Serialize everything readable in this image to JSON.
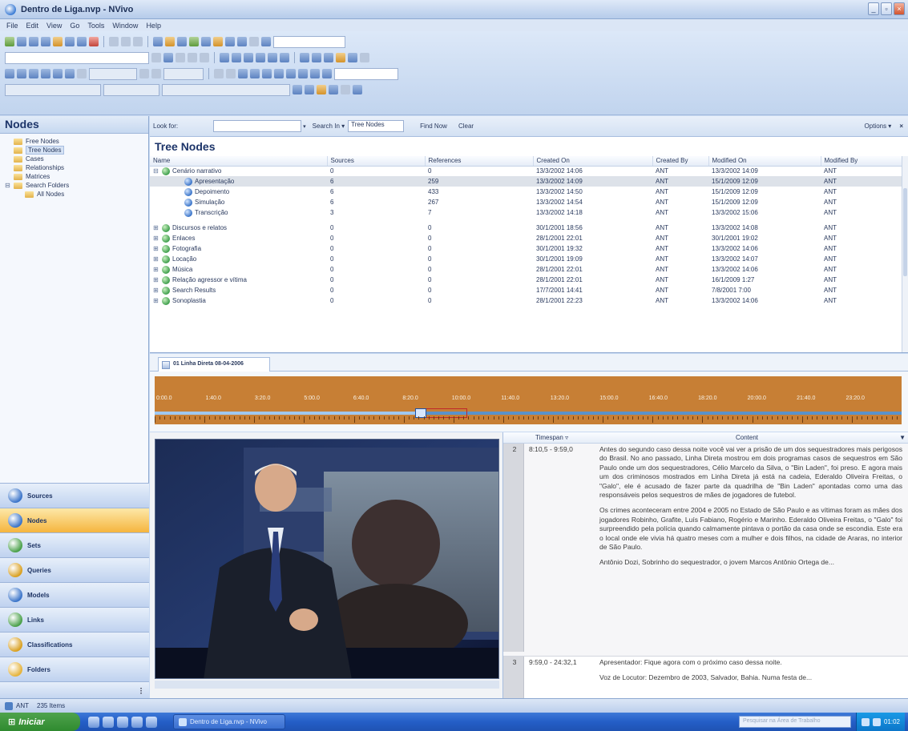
{
  "window": {
    "title": "Dentro de Liga.nvp - NVivo",
    "min_glyph": "_",
    "max_glyph": "▫",
    "close_glyph": "×"
  },
  "menu": [
    "File",
    "Edit",
    "View",
    "Go",
    "Tools",
    "Window",
    "Help"
  ],
  "nav": {
    "header": "Nodes",
    "tree": [
      {
        "label": "Free Nodes",
        "indent": 0,
        "icon": "folder-icon",
        "selected": false,
        "expander": ""
      },
      {
        "label": "Tree Nodes",
        "indent": 0,
        "icon": "folder-icon",
        "selected": true,
        "expander": ""
      },
      {
        "label": "Cases",
        "indent": 0,
        "icon": "folder-icon",
        "selected": false,
        "expander": ""
      },
      {
        "label": "Relationships",
        "indent": 0,
        "icon": "folder-icon",
        "selected": false,
        "expander": ""
      },
      {
        "label": "Matrices",
        "indent": 0,
        "icon": "folder-icon",
        "selected": false,
        "expander": ""
      },
      {
        "label": "Search Folders",
        "indent": 0,
        "icon": "folder-icon",
        "selected": false,
        "expander": "⊟"
      },
      {
        "label": "All Nodes",
        "indent": 1,
        "icon": "folder-icon",
        "selected": false,
        "expander": ""
      }
    ],
    "buttons": [
      {
        "label": "Sources",
        "icon": "sources-icon",
        "active": false
      },
      {
        "label": "Nodes",
        "icon": "nodes-icon",
        "active": true
      },
      {
        "label": "Sets",
        "icon": "sets-icon",
        "active": false
      },
      {
        "label": "Queries",
        "icon": "queries-icon",
        "active": false
      },
      {
        "label": "Models",
        "icon": "models-icon",
        "active": false
      },
      {
        "label": "Links",
        "icon": "links-icon",
        "active": false
      },
      {
        "label": "Classifications",
        "icon": "classifications-icon",
        "active": false
      },
      {
        "label": "Folders",
        "icon": "folders-icon",
        "active": false
      }
    ],
    "configure_glyph": "⁝"
  },
  "findbar": {
    "look_for_label": "Look for:",
    "search_in_label": "Search In ▾",
    "search_in_value": "Tree Nodes",
    "find_now": "Find Now",
    "clear": "Clear",
    "options": "Options ▾",
    "close_glyph": "×"
  },
  "list": {
    "title": "Tree Nodes",
    "columns": [
      "Name",
      "Sources",
      "References",
      "Created On",
      "Created By",
      "Modified On",
      "Modified By"
    ],
    "rows": [
      {
        "name": "Cenário narrativo",
        "sources": "0",
        "references": "0",
        "created_on": "13/3/2002 14:06",
        "created_by": "ANT",
        "modified_on": "13/3/2002 14:09",
        "modified_by": "ANT",
        "level": 0,
        "expander": "⊟",
        "selected": false,
        "gap_after": false
      },
      {
        "name": "Apresentação",
        "sources": "6",
        "references": "259",
        "created_on": "13/3/2002 14:09",
        "created_by": "ANT",
        "modified_on": "15/1/2009 12:09",
        "modified_by": "ANT",
        "level": 1,
        "expander": "",
        "selected": true,
        "gap_after": false
      },
      {
        "name": "Depoimento",
        "sources": "6",
        "references": "433",
        "created_on": "13/3/2002 14:50",
        "created_by": "ANT",
        "modified_on": "15/1/2009 12:09",
        "modified_by": "ANT",
        "level": 1,
        "expander": "",
        "selected": false,
        "gap_after": false
      },
      {
        "name": "Simulação",
        "sources": "6",
        "references": "267",
        "created_on": "13/3/2002 14:54",
        "created_by": "ANT",
        "modified_on": "15/1/2009 12:09",
        "modified_by": "ANT",
        "level": 1,
        "expander": "",
        "selected": false,
        "gap_after": false
      },
      {
        "name": "Transcrição",
        "sources": "3",
        "references": "7",
        "created_on": "13/3/2002 14:18",
        "created_by": "ANT",
        "modified_on": "13/3/2002 15:06",
        "modified_by": "ANT",
        "level": 1,
        "expander": "",
        "selected": false,
        "gap_after": true
      },
      {
        "name": "Discursos e relatos",
        "sources": "0",
        "references": "0",
        "created_on": "30/1/2001 18:56",
        "created_by": "ANT",
        "modified_on": "13/3/2002 14:08",
        "modified_by": "ANT",
        "level": 0,
        "expander": "⊞",
        "selected": false,
        "gap_after": false
      },
      {
        "name": "Enlaces",
        "sources": "0",
        "references": "0",
        "created_on": "28/1/2001 22:01",
        "created_by": "ANT",
        "modified_on": "30/1/2001 19:02",
        "modified_by": "ANT",
        "level": 0,
        "expander": "⊞",
        "selected": false,
        "gap_after": false
      },
      {
        "name": "Fotografia",
        "sources": "0",
        "references": "0",
        "created_on": "30/1/2001 19:32",
        "created_by": "ANT",
        "modified_on": "13/3/2002 14:06",
        "modified_by": "ANT",
        "level": 0,
        "expander": "⊞",
        "selected": false,
        "gap_after": false
      },
      {
        "name": "Locação",
        "sources": "0",
        "references": "0",
        "created_on": "30/1/2001 19:09",
        "created_by": "ANT",
        "modified_on": "13/3/2002 14:07",
        "modified_by": "ANT",
        "level": 0,
        "expander": "⊞",
        "selected": false,
        "gap_after": false
      },
      {
        "name": "Música",
        "sources": "0",
        "references": "0",
        "created_on": "28/1/2001 22:01",
        "created_by": "ANT",
        "modified_on": "13/3/2002 14:06",
        "modified_by": "ANT",
        "level": 0,
        "expander": "⊞",
        "selected": false,
        "gap_after": false
      },
      {
        "name": "Relação agressor e vítima",
        "sources": "0",
        "references": "0",
        "created_on": "28/1/2001 22:01",
        "created_by": "ANT",
        "modified_on": "16/1/2009 1:27",
        "modified_by": "ANT",
        "level": 0,
        "expander": "⊞",
        "selected": false,
        "gap_after": false
      },
      {
        "name": "Search Results",
        "sources": "0",
        "references": "0",
        "created_on": "17/7/2001 14:41",
        "created_by": "ANT",
        "modified_on": "7/8/2001 7:00",
        "modified_by": "ANT",
        "level": 0,
        "expander": "⊞",
        "selected": false,
        "gap_after": false
      },
      {
        "name": "Sonoplastia",
        "sources": "0",
        "references": "0",
        "created_on": "28/1/2001 22:23",
        "created_by": "ANT",
        "modified_on": "13/3/2002 14:06",
        "modified_by": "ANT",
        "level": 0,
        "expander": "⊞",
        "selected": false,
        "gap_after": false
      }
    ]
  },
  "doc_tab": {
    "label": "01 Linha Direta 08-04-2006"
  },
  "timeline": {
    "labels": [
      "0:00.0",
      "1:40.0",
      "3:20.0",
      "5:00.0",
      "6:40.0",
      "8:20.0",
      "10:00.0",
      "11:40.0",
      "13:20.0",
      "15:00.0",
      "16:40.0",
      "18:20.0",
      "20:00.0",
      "21:40.0",
      "23:20.0"
    ],
    "played_fraction": 0.355
  },
  "transcript": {
    "col_timespan": "Timespan",
    "col_content": "Content",
    "sort_glyph": "▿",
    "filter_glyph": "▼",
    "rows": [
      {
        "num": "2",
        "timespan": "8:10,5 - 9:59,0",
        "paragraphs": [
          "Antes do segundo caso dessa noite você vai ver a prisão de um dos sequestradores mais perigosos do Brasil. No ano passado, Linha Direta mostrou em dois programas casos de sequestros em São Paulo onde um dos sequestradores, Célio Marcelo da Silva, o \"Bin Laden\", foi preso. E agora mais um dos criminosos mostrados em Linha Direta já está na cadeia, Ederaldo Oliveira Freitas, o \"Galo\", ele é acusado de fazer parte da quadrilha de \"Bin Laden\" apontadas como uma das responsáveis pelos sequestros de mães de jogadores de futebol.",
          "Os crimes aconteceram entre 2004 e 2005 no Estado de São Paulo e as vítimas foram as mães dos jogadores Robinho, Grafite, Luís Fabiano, Rogério e Marinho. Ederaldo Oliveira Freitas, o \"Galo\" foi surpreendido pela polícia quando calmamente pintava o portão da casa onde se escondia. Este era o local onde ele vivia há quatro meses com a mulher e dois filhos, na cidade de Araras, no interior de São Paulo.",
          "Antônio Dozi, Sobrinho do sequestrador, o jovem Marcos Antônio Ortega de..."
        ]
      },
      {
        "num": "3",
        "timespan": "9:59,0 - 24:32,1",
        "paragraphs": [
          "Apresentador: Fique agora com o próximo caso dessa noite.",
          "Voz de Locutor: Dezembro de 2003, Salvador, Bahia. Numa festa de..."
        ]
      }
    ]
  },
  "status": {
    "user": "ANT",
    "count": "235 Items"
  },
  "taskbar": {
    "start": "Iniciar",
    "task": "Dentro de Liga.nvp - NVivo",
    "search_placeholder": "Pesquisar na Área de Trabalho",
    "clock": "01:02"
  },
  "colors": {
    "accent": "#f5b53e",
    "timeline": "#c77f35",
    "selection": "#dde2e9"
  }
}
